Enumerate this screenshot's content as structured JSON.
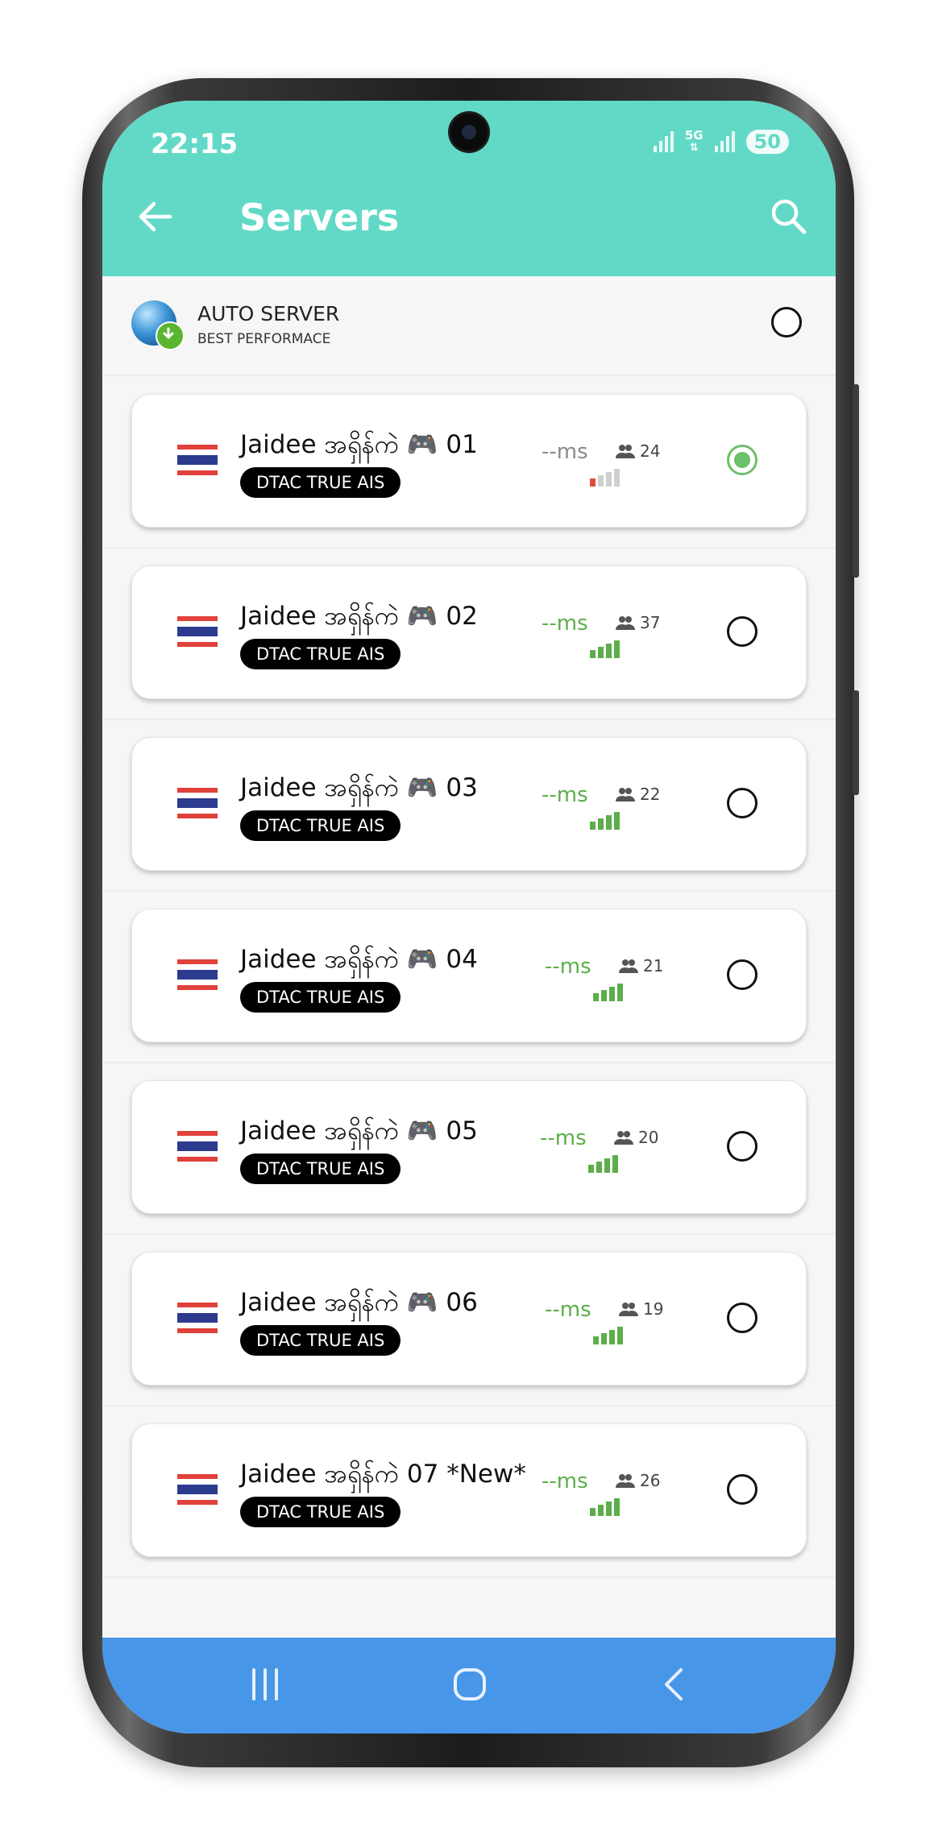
{
  "status_bar": {
    "time": "22:15",
    "network_label": "5G",
    "battery": "50"
  },
  "header": {
    "title": "Servers",
    "back_icon": "arrow-left-icon",
    "search_icon": "search-icon"
  },
  "auto_server": {
    "title": "AUTO SERVER",
    "subtitle": "BEST PERFORMACE",
    "icon": "globe-icon",
    "selected": false
  },
  "servers": [
    {
      "name": "Jaidee အရှိန်ကဲ 🎮 01",
      "tag": "DTAC TRUE AIS",
      "ping": "--ms",
      "users": "24",
      "signal_level": 1,
      "signal_color": "#e04b3b",
      "selected": true
    },
    {
      "name": "Jaidee အရှိန်ကဲ 🎮 02",
      "tag": "DTAC TRUE AIS",
      "ping": "--ms",
      "users": "37",
      "signal_level": 4,
      "signal_color": "#5cae4a",
      "selected": false
    },
    {
      "name": "Jaidee အရှိန်ကဲ 🎮 03",
      "tag": "DTAC TRUE AIS",
      "ping": "--ms",
      "users": "22",
      "signal_level": 4,
      "signal_color": "#5cae4a",
      "selected": false
    },
    {
      "name": "Jaidee အရှိန်ကဲ 🎮 04",
      "tag": "DTAC TRUE AIS",
      "ping": "--ms",
      "users": "21",
      "signal_level": 4,
      "signal_color": "#5cae4a",
      "selected": false
    },
    {
      "name": "Jaidee အရှိန်ကဲ 🎮 05",
      "tag": "DTAC TRUE AIS",
      "ping": "--ms",
      "users": "20",
      "signal_level": 4,
      "signal_color": "#5cae4a",
      "selected": false
    },
    {
      "name": "Jaidee အရှိန်ကဲ 🎮 06",
      "tag": "DTAC TRUE AIS",
      "ping": "--ms",
      "users": "19",
      "signal_level": 4,
      "signal_color": "#5cae4a",
      "selected": false
    },
    {
      "name": "Jaidee အရှိန်ကဲ 07 *New*",
      "tag": "DTAC TRUE AIS",
      "ping": "--ms",
      "users": "26",
      "signal_level": 4,
      "signal_color": "#5cae4a",
      "selected": false
    }
  ],
  "colors": {
    "header_bg": "#62d9c6",
    "nav_bg": "#4896e8",
    "selected": "#6cc06a",
    "ping_good": "#5cae4a",
    "ping_unknown": "#8a8a8a"
  },
  "nav": {
    "recent_icon": "recent-apps-icon",
    "home_icon": "home-icon",
    "back_icon": "back-chevron-icon"
  }
}
